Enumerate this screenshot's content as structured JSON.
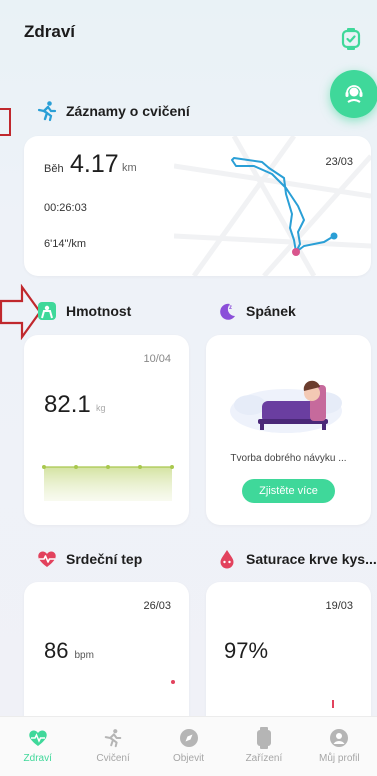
{
  "header": {
    "title": "Zdraví"
  },
  "exercise": {
    "section_title": "Záznamy o cvičení",
    "type": "Běh",
    "distance": "4.17",
    "unit": "km",
    "date": "23/03",
    "duration": "00:26:03",
    "pace": "6'14\"/km"
  },
  "weight": {
    "section_title": "Hmotnost",
    "date": "10/04",
    "value": "82.1",
    "unit": "kg"
  },
  "sleep": {
    "section_title": "Spánek",
    "text": "Tvorba dobrého návyku ...",
    "button_label": "Zjistěte více"
  },
  "heart": {
    "section_title": "Srdeční tep",
    "date": "26/03",
    "value": "86",
    "unit": "bpm"
  },
  "spo2": {
    "section_title": "Saturace krve kys...",
    "date": "19/03",
    "value": "97%"
  },
  "nav": {
    "items": [
      {
        "label": "Zdraví",
        "icon": "heart-icon"
      },
      {
        "label": "Cvičení",
        "icon": "runner-icon"
      },
      {
        "label": "Objevit",
        "icon": "compass-icon"
      },
      {
        "label": "Zařízení",
        "icon": "watch-icon"
      },
      {
        "label": "Můj profil",
        "icon": "user-icon"
      }
    ]
  },
  "colors": {
    "accent": "#3fd89a",
    "route": "#2a9fd6",
    "sleep_purple": "#8b4fd9",
    "heart_red": "#e2425d",
    "annotation_red": "#c0282d"
  }
}
